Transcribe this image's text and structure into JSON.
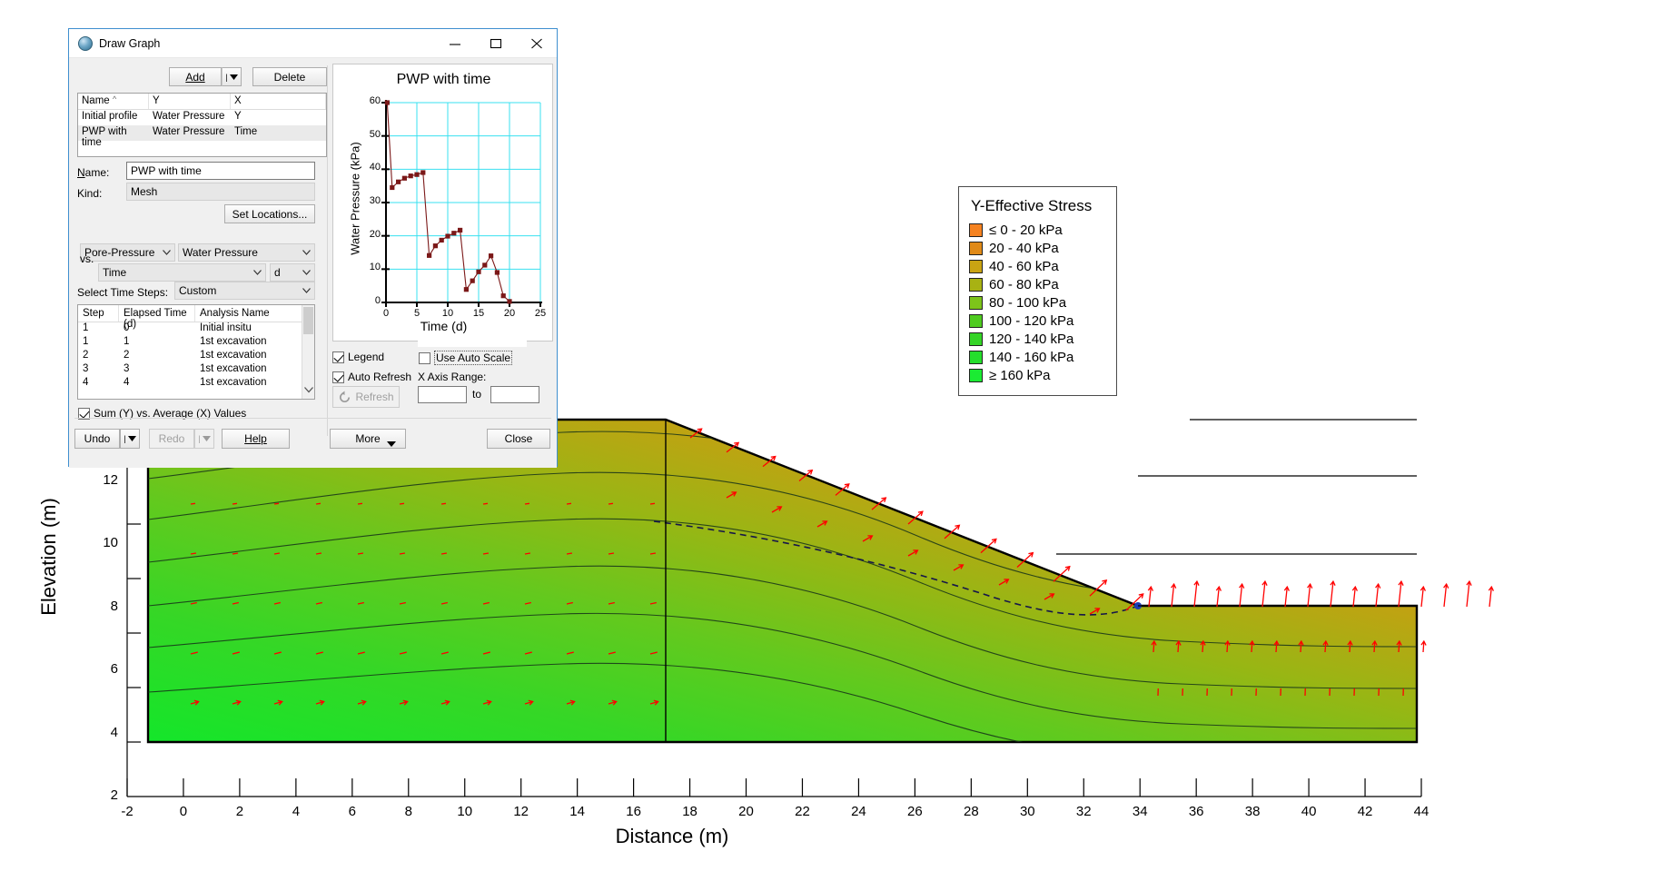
{
  "dialog": {
    "title": "Draw Graph",
    "window_buttons": {
      "minimize": "minimize-icon",
      "maximize": "maximize-icon",
      "close": "close-icon"
    },
    "add_label": "Add",
    "delete_label": "Delete",
    "grid": {
      "headers": [
        "Name",
        "Y",
        "X"
      ],
      "rows": [
        {
          "name": "Initial profile",
          "y": "Water Pressure",
          "x": "Y"
        },
        {
          "name": "PWP with time",
          "y": "Water Pressure",
          "x": "Time"
        }
      ],
      "selected_index": 1
    },
    "name_label": "Name:",
    "name_value": "PWP with time",
    "kind_label": "Kind:",
    "kind_value": "Mesh",
    "set_locations_label": "Set Locations...",
    "pore_pressure_value": "Pore-Pressure",
    "water_pressure_value": "Water Pressure",
    "vs_label": "vs.",
    "vs_value": "Time",
    "unit_value": "d",
    "time_steps_label": "Select Time Steps:",
    "time_steps_value": "Custom",
    "step_table": {
      "headers": [
        "Step",
        "Elapsed Time (d)",
        "Analysis Name"
      ],
      "rows": [
        {
          "step": "1",
          "elapsed": "0",
          "analysis": "Initial insitu"
        },
        {
          "step": "1",
          "elapsed": "1",
          "analysis": "1st excavation"
        },
        {
          "step": "2",
          "elapsed": "2",
          "analysis": "1st excavation"
        },
        {
          "step": "3",
          "elapsed": "3",
          "analysis": "1st excavation"
        },
        {
          "step": "4",
          "elapsed": "4",
          "analysis": "1st excavation"
        }
      ]
    },
    "sum_avg_label": "Sum (Y) vs. Average (X) Values",
    "sum_avg_checked": true,
    "legend_checkbox_label": "Legend",
    "legend_checked": true,
    "auto_refresh_label": "Auto Refresh",
    "auto_refresh_checked": true,
    "use_auto_scale_label": "Use Auto Scale",
    "use_auto_scale_checked": false,
    "x_axis_range_label": "X Axis Range:",
    "x_axis_range_from": "",
    "x_axis_range_to_label": "to",
    "x_axis_range_to": "",
    "refresh_label": "Refresh",
    "undo_label": "Undo",
    "redo_label": "Redo",
    "help_label": "Help",
    "more_label": "More",
    "close_label": "Close"
  },
  "legend": {
    "title": "Y-Effective Stress",
    "items": [
      {
        "label": "≤ 0 - 20 kPa",
        "color": "#F58220"
      },
      {
        "label": "20 - 40 kPa",
        "color": "#E08A18"
      },
      {
        "label": "40 - 60 kPa",
        "color": "#C9A413"
      },
      {
        "label": "60 - 80 kPa",
        "color": "#A8B213"
      },
      {
        "label": "80 - 100 kPa",
        "color": "#7DC41A"
      },
      {
        "label": "100 - 120 kPa",
        "color": "#4ECB1F"
      },
      {
        "label": "120 - 140 kPa",
        "color": "#34D426"
      },
      {
        "label": "140 - 160 kPa",
        "color": "#25DE2C"
      },
      {
        "label": "≥ 160 kPa",
        "color": "#1BEB33"
      }
    ]
  },
  "chart_data": [
    {
      "id": "pwp-with-time",
      "type": "line",
      "title": "PWP with time",
      "xlabel": "Time (d)",
      "ylabel": "Water Pressure (kPa)",
      "xlim": [
        0,
        25
      ],
      "ylim": [
        0,
        60
      ],
      "xticks": [
        0,
        5,
        10,
        15,
        20,
        25
      ],
      "yticks": [
        0,
        10,
        20,
        30,
        40,
        50,
        60
      ],
      "grid": true,
      "grid_color": "#38E0F0",
      "series_color": "#7B1818",
      "marker": "square",
      "series": [
        {
          "name": "PWP with time",
          "x": [
            0.2,
            1.0,
            2.0,
            3.0,
            4.0,
            5.0,
            6.0,
            7.0,
            8.0,
            9.0,
            10.0,
            11.0,
            12.0,
            13.0,
            14.0,
            15.0,
            16.0,
            17.0,
            18.0,
            19.0,
            20.0
          ],
          "y": [
            60.0,
            34.5,
            36.2,
            37.3,
            38.0,
            38.4,
            39.0,
            14.1,
            17.0,
            18.7,
            19.9,
            20.8,
            21.7,
            3.9,
            6.5,
            9.2,
            11.2,
            14.0,
            9.0,
            2.0,
            0.3
          ]
        }
      ]
    },
    {
      "id": "slope-contour",
      "type": "contour",
      "title": "",
      "xlabel": "Distance (m)",
      "ylabel": "Elevation (m)",
      "xlim": [
        -2,
        44
      ],
      "ylim": [
        2,
        14
      ],
      "xticks": [
        -2,
        0,
        2,
        4,
        6,
        8,
        10,
        12,
        14,
        16,
        18,
        20,
        22,
        24,
        26,
        28,
        30,
        32,
        34,
        36,
        38,
        40,
        42,
        44
      ],
      "yticks": [
        2,
        4,
        6,
        8,
        10,
        12
      ],
      "grid": false,
      "vector_color": "#FF0000",
      "contour_line_color": "#1b3a1b"
    }
  ],
  "geoplot": {
    "xlabel": "Distance (m)",
    "ylabel": "Elevation (m)",
    "xticks": [
      "-2",
      "0",
      "2",
      "4",
      "6",
      "8",
      "10",
      "12",
      "14",
      "16",
      "18",
      "20",
      "22",
      "24",
      "26",
      "28",
      "30",
      "32",
      "34",
      "36",
      "38",
      "40",
      "42",
      "44"
    ],
    "yticks": [
      "2",
      "4",
      "6",
      "8",
      "10",
      "12"
    ]
  }
}
